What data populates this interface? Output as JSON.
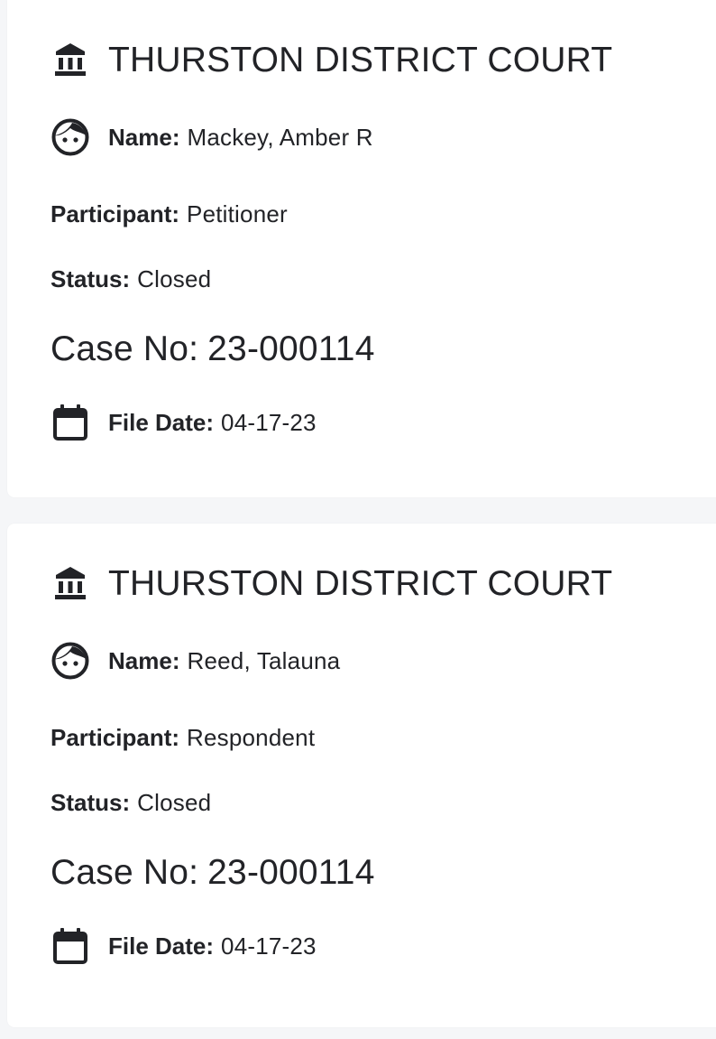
{
  "results": [
    {
      "court": "THURSTON DISTRICT COURT",
      "name_label": "Name:",
      "name": "Mackey, Amber R",
      "participant_label": "Participant:",
      "participant": "Petitioner",
      "status_label": "Status:",
      "status": "Closed",
      "case_label": "Case No:",
      "case_number": "23-000114",
      "file_date_label": "File Date:",
      "file_date": "04-17-23",
      "icons": {
        "court": "courthouse-icon",
        "person": "face-icon",
        "date": "calendar-icon"
      }
    },
    {
      "court": "THURSTON DISTRICT COURT",
      "name_label": "Name:",
      "name": "Reed, Talauna",
      "participant_label": "Participant:",
      "participant": "Respondent",
      "status_label": "Status:",
      "status": "Closed",
      "case_label": "Case No:",
      "case_number": "23-000114",
      "file_date_label": "File Date:",
      "file_date": "04-17-23",
      "icons": {
        "court": "courthouse-icon",
        "person": "face-icon",
        "date": "calendar-icon"
      }
    }
  ],
  "colors": {
    "background": "#f5f6f8",
    "card": "#ffffff",
    "text": "#222327"
  }
}
